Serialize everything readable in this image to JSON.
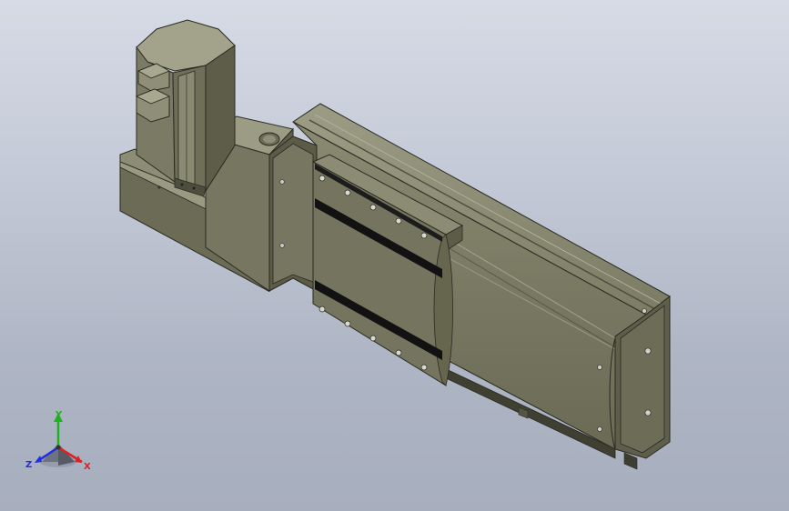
{
  "viewport": {
    "background_top": "#d6dbe6",
    "background_bottom": "#a7aebd"
  },
  "model": {
    "body_color": "#7a7a64",
    "dark_color": "#4a4a3a",
    "light_color": "#9b9b84",
    "slot_color": "#121212"
  },
  "triad": {
    "x_label": "X",
    "y_label": "Y",
    "z_label": "Z",
    "x_color": "#e02020",
    "y_color": "#20b020",
    "z_color": "#2030e0"
  }
}
